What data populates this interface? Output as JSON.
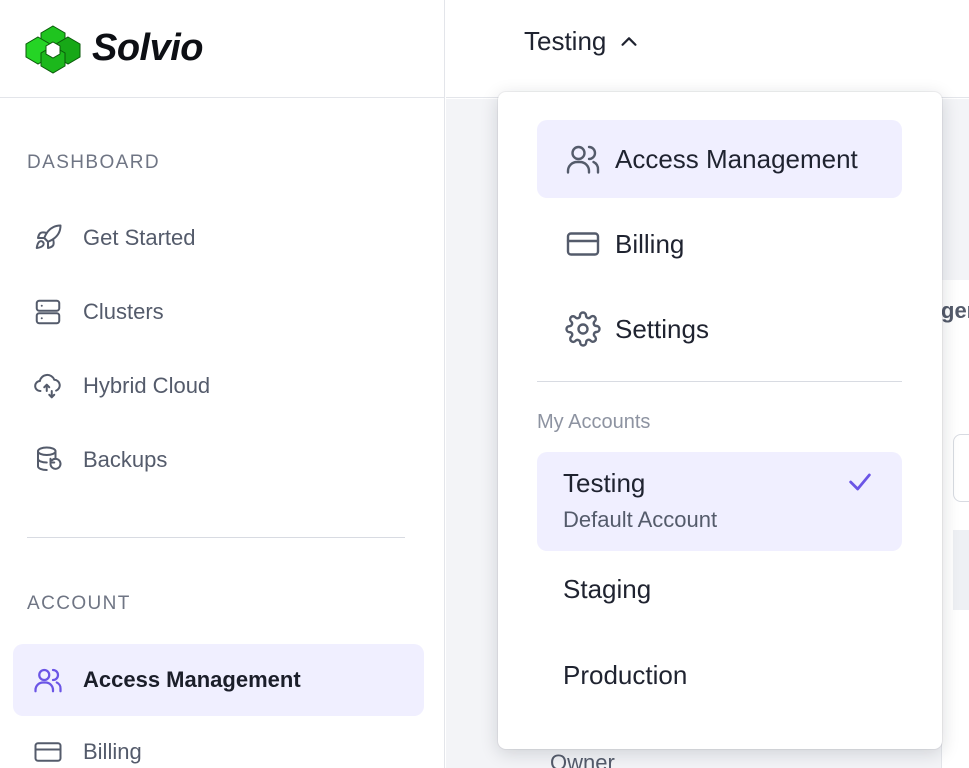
{
  "app": {
    "name": "Solvio"
  },
  "sidebar": {
    "dashboard_label": "DASHBOARD",
    "dashboard_items": [
      {
        "label": "Get Started",
        "icon": "rocket-icon"
      },
      {
        "label": "Clusters",
        "icon": "server-icon"
      },
      {
        "label": "Hybrid Cloud",
        "icon": "cloud-sync-icon"
      },
      {
        "label": "Backups",
        "icon": "database-restore-icon"
      }
    ],
    "account_label": "ACCOUNT",
    "account_items": [
      {
        "label": "Access Management",
        "icon": "users-icon",
        "active": true
      },
      {
        "label": "Billing",
        "icon": "credit-card-icon"
      }
    ]
  },
  "header": {
    "current_account": "Testing"
  },
  "dropdown": {
    "menu_items": [
      {
        "label": "Access Management",
        "icon": "users-icon",
        "active": true
      },
      {
        "label": "Billing",
        "icon": "credit-card-icon"
      },
      {
        "label": "Settings",
        "icon": "gear-icon"
      }
    ],
    "accounts_section_label": "My Accounts",
    "accounts": [
      {
        "name": "Testing",
        "subtitle": "Default Account",
        "selected": true
      },
      {
        "name": "Staging"
      },
      {
        "name": "Production"
      }
    ]
  },
  "background": {
    "tab_fragment": "ger",
    "list_fragment": "Owner"
  },
  "colors": {
    "accent": "#6b55e6",
    "active_bg": "#f0efff",
    "logo_green": "#1fc41f"
  }
}
